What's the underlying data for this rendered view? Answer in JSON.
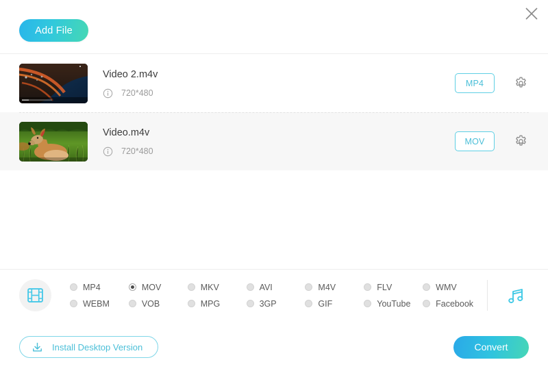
{
  "window": {
    "close_label": "×"
  },
  "toolbar": {
    "add_file_label": "Add File"
  },
  "files": [
    {
      "name": "Video 2.m4v",
      "dimensions": "720*480",
      "format": "MP4",
      "thumbnail": "aerial-coastline",
      "highlighted": false
    },
    {
      "name": "Video.m4v",
      "dimensions": "720*480",
      "format": "MOV",
      "thumbnail": "deer-in-grass",
      "highlighted": true
    }
  ],
  "format_panel": {
    "media_type_icon": "film-strip-icon",
    "audio_icon": "music-note-icon",
    "options": [
      {
        "label": "MP4",
        "selected": false
      },
      {
        "label": "MOV",
        "selected": true
      },
      {
        "label": "MKV",
        "selected": false
      },
      {
        "label": "AVI",
        "selected": false
      },
      {
        "label": "M4V",
        "selected": false
      },
      {
        "label": "FLV",
        "selected": false
      },
      {
        "label": "WMV",
        "selected": false
      },
      {
        "label": "WEBM",
        "selected": false
      },
      {
        "label": "VOB",
        "selected": false
      },
      {
        "label": "MPG",
        "selected": false
      },
      {
        "label": "3GP",
        "selected": false
      },
      {
        "label": "GIF",
        "selected": false
      },
      {
        "label": "YouTube",
        "selected": false
      },
      {
        "label": "Facebook",
        "selected": false
      }
    ]
  },
  "footer": {
    "install_label": "Install Desktop Version",
    "install_icon": "download-icon",
    "convert_label": "Convert"
  },
  "colors": {
    "accent_cyan": "#4bbfd8",
    "gradient_start": "#2aa9e8",
    "gradient_end": "#46d6b6",
    "row_highlight": "#f7f7f7",
    "text_primary": "#3c3c3c",
    "text_muted": "#9b9b9b"
  }
}
